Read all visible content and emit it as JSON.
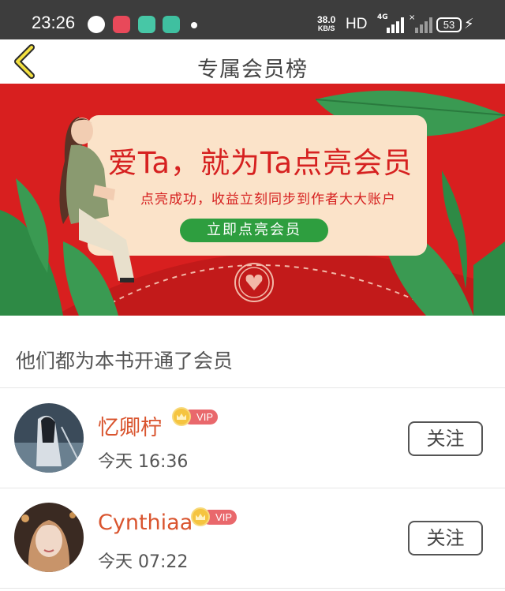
{
  "status_bar": {
    "time": "23:26",
    "net_speed_value": "38.0",
    "net_speed_unit": "KB/S",
    "hd_label": "HD",
    "network_type": "4G",
    "battery": "53",
    "app_icons": [
      "app-notification-icon-1",
      "app-notification-icon-2",
      "app-notification-icon-3",
      "app-notification-icon-4"
    ]
  },
  "header": {
    "title": "专属会员榜",
    "back_icon": "chevron-left-icon"
  },
  "banner": {
    "headline": "爱Ta，就为Ta点亮会员",
    "subline": "点亮成功，收益立刻同步到作者大大账户",
    "cta_label": "立即点亮会员",
    "colors": {
      "background": "#d81f1f",
      "card": "#fbe3c9",
      "cta": "#2e9e3f"
    }
  },
  "section": {
    "title": "他们都为本书开通了会员"
  },
  "members": [
    {
      "name": "忆卿柠",
      "badge": "VIP",
      "time": "今天 16:36",
      "follow_label": "关注"
    },
    {
      "name": "Cynthiaa",
      "badge": "VIP",
      "time": "今天 07:22",
      "follow_label": "关注"
    }
  ],
  "colors": {
    "name": "#d9542e",
    "vip_tag": "#e9686c",
    "vip_crown": "#f5c440"
  }
}
